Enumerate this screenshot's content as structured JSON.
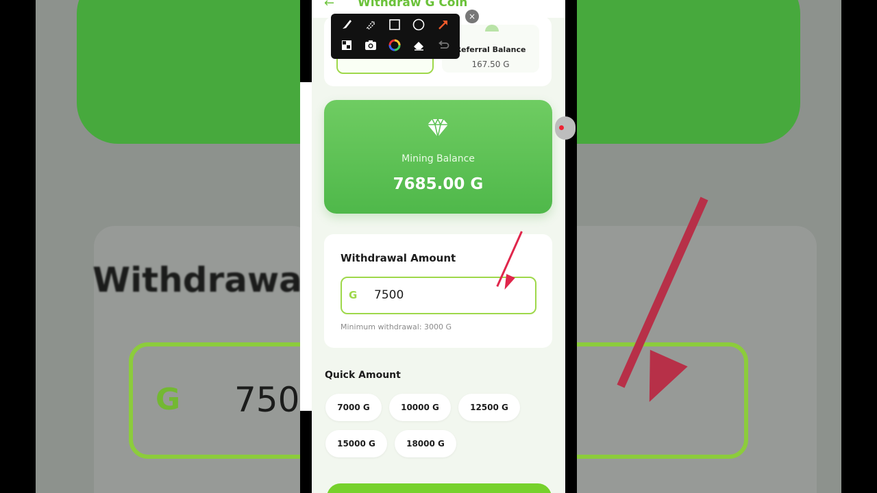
{
  "background": {
    "title_fragment": "Withdrawa",
    "g_symbol": "G",
    "value_fragment": "750"
  },
  "header": {
    "title": "Withdraw G Coin"
  },
  "balance_tabs": {
    "referral_label": "Referral Balance",
    "referral_value": "167.50 G"
  },
  "toolbar": {
    "tools": [
      "brush",
      "highlighter",
      "rectangle",
      "circle",
      "arrow",
      "mosaic",
      "camera",
      "color-wheel",
      "eraser",
      "undo"
    ],
    "close_label": "×"
  },
  "mining_card": {
    "label": "Mining Balance",
    "value": "7685.00 G"
  },
  "withdrawal": {
    "title": "Withdrawal Amount",
    "currency_symbol": "G",
    "amount": "7500",
    "hint": "Minimum withdrawal: 3000 G"
  },
  "quick_amount": {
    "title": "Quick Amount",
    "options": [
      "7000 G",
      "10000 G",
      "12500 G",
      "15000 G",
      "18000 G"
    ]
  },
  "colors": {
    "accent": "#6bc23a",
    "card_green": "#5cc154",
    "input_border": "#9ed84a",
    "annotation_red": "#e0264b"
  }
}
